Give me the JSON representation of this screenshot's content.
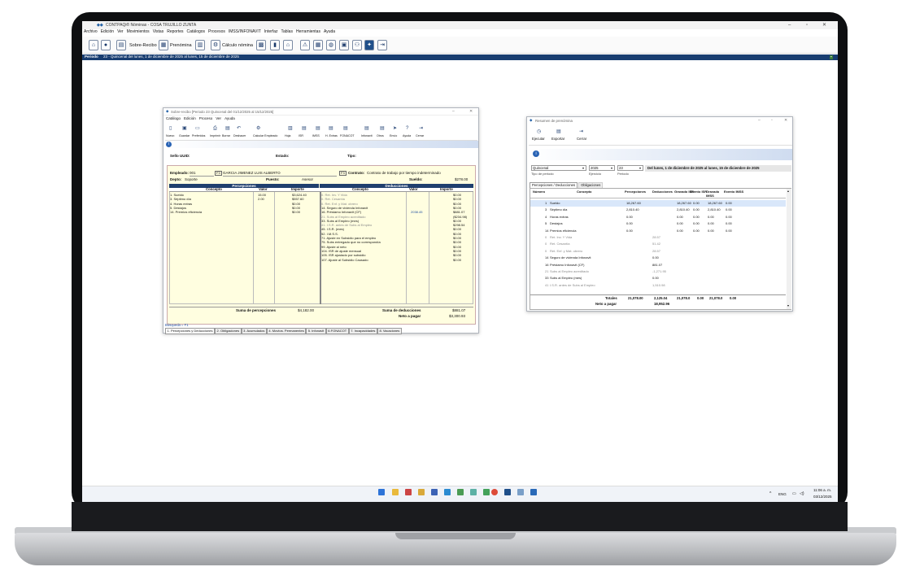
{
  "app": {
    "title": "CONTPAQi® Nóminas - COSA TRUJILLO ZUNTA",
    "menu": [
      "Archivo",
      "Edición",
      "Ver",
      "Movimientos",
      "Vistas",
      "Reportes",
      "Catálogos",
      "Procesos",
      "IMSS/INFONAVIT",
      "Interfaz",
      "Tablas",
      "Herramientas",
      "Ayuda"
    ],
    "toolbar": {
      "sobre_recibo": "Sobre-Recibo",
      "prenomina": "Prenómina",
      "calculo": "Cálculo nómina"
    },
    "period_label": "Periodo",
    "period_text": "23 - Quincenal del lunes, 1 de diciembre de 2025 al lunes, 15 de diciembre de 2025"
  },
  "sobre": {
    "title": "Sobre-recibo [Periodo 23 Quincenal del 01/12/2025 al 15/12/2025]",
    "menu": [
      "Catálogo",
      "Edición",
      "Proceso",
      "Ver",
      "Ayuda"
    ],
    "ribbon": [
      "Nuevo",
      "Guardar",
      "Preferidos",
      "Imprimir",
      "Borrar",
      "Deshacer",
      "Calcular Empleado",
      "Hoja",
      "ISR",
      "IMSS",
      "H. Extras",
      "FONACOT",
      "Infonavit",
      "Otros",
      "Envío",
      "Ayuda",
      "Cerrar"
    ],
    "sello_label": "Sello UUID:",
    "estado_label": "Estado:",
    "tipo_label": "Tipo:",
    "empleado_label": "Empleado:",
    "empleado_code": "001",
    "empleado_name": "GARCIA JIMENEZ LUIS ALBERTO",
    "contrato_label": "Contrato:",
    "contrato_value": "Contrato de trabajo por tiempo indeterminado",
    "depto_label": "Depto:",
    "depto_value": "Soporte",
    "puesto_label": "Puesto:",
    "puesto_value": "Asesor",
    "sueldo_label": "Sueldo:",
    "sueldo_value": "$278.00",
    "percepciones_header": "Percepciones",
    "deducciones_header": "Deducciones",
    "col_concepto": "Concepto",
    "col_valor": "Valor",
    "col_importe": "Importe",
    "percepciones": [
      {
        "c": "1. Sueldo",
        "v": "15.00",
        "i": "$3,624.40"
      },
      {
        "c": "3. Séptimo día",
        "v": "2.00",
        "i": "$557.60"
      },
      {
        "c": "4. Horas extras",
        "v": "",
        "i": "$0.00"
      },
      {
        "c": "5. Destajos",
        "v": "",
        "i": "$0.00"
      },
      {
        "c": "14. Premios eficiencia",
        "v": "",
        "i": "$0.00"
      }
    ],
    "deducciones": [
      {
        "c": "0. Ret. Inv. Y Vida",
        "v": "",
        "i": "$0.00",
        "g": true
      },
      {
        "c": "0. Ret. Cesantía",
        "v": "",
        "i": "$0.00",
        "g": true
      },
      {
        "c": "0. Ret. Enf. y Mat. obrero",
        "v": "",
        "i": "$0.00",
        "g": true
      },
      {
        "c": "14. Seguro de vivienda Infonavit",
        "v": "",
        "i": "$0.00",
        "g": false
      },
      {
        "c": "16. Préstamo Infonavit (CF)",
        "v": "2038.45",
        "i": "$881.07",
        "g": false
      },
      {
        "c": "21. Subs al Empleo acreditado",
        "v": "",
        "i": "($234.98)",
        "g": true
      },
      {
        "c": "33. Subs al Empleo (mes)",
        "v": "",
        "i": "$0.00",
        "g": false
      },
      {
        "c": "41. I.S.R. antes de Subs al Empleo",
        "v": "",
        "i": "$298.54",
        "g": true
      },
      {
        "c": "45. I.S.R. (mes)",
        "v": "",
        "i": "$0.00",
        "g": false
      },
      {
        "c": "52. I.M.S.S.",
        "v": "",
        "i": "$0.00",
        "g": false
      },
      {
        "c": "71. Ajuste en Subsidio para el empleo",
        "v": "",
        "i": "$0.00",
        "g": false
      },
      {
        "c": "75. Subs entregado que no correspondía",
        "v": "",
        "i": "$0.00",
        "g": false
      },
      {
        "c": "99. Ajuste al neto",
        "v": "",
        "i": "$0.00",
        "g": false
      },
      {
        "c": "104. ISR de ajuste mensual",
        "v": "",
        "i": "$0.00",
        "g": false
      },
      {
        "c": "105. ISR ajustado por subsidio",
        "v": "",
        "i": "$0.00",
        "g": false
      },
      {
        "c": "107. Ajuste al Subsidio Causado",
        "v": "",
        "i": "$0.00",
        "g": false
      }
    ],
    "suma_percepciones_label": "Suma de percepciones",
    "suma_percepciones": "$4,182.00",
    "suma_deducciones_label": "Suma de deducciones",
    "suma_deducciones": "$881.07",
    "neto_label": "Neto a pagar",
    "neto": "$3,300.93",
    "busqueda": "Búsqueda = F1",
    "tabs": [
      "1. Percepciones y Deducciones",
      "2. Obligaciones",
      "3. Acumulados",
      "4. Movtos. Permanentes",
      "5. Infonavit",
      "6.FONACOT",
      "7. Incapacidades",
      "8. Vacaciones"
    ]
  },
  "resumen": {
    "title": "Resumen de prenómina",
    "ribbon": [
      "Ejecutar",
      "Exportar",
      "Cerrar"
    ],
    "tipo_periodo": "Quincenal",
    "tipo_periodo_label": "Tipo de periodo",
    "ejercicio": "2025",
    "ejercicio_label": "Ejercicio",
    "periodo": "23",
    "periodo_label": "Periodo",
    "range": "Del lunes, 1 de diciembre de 2025 al lunes, 15 de diciembre de 2025",
    "tabs": [
      "Percepciones / Deducciones",
      "Obligaciones"
    ],
    "headers": [
      "Número",
      "Concepto",
      "Percepciones",
      "Deducciones",
      "Gravado ISR",
      "Exento ISR",
      "Gravado IMSS",
      "Exento IMSS"
    ],
    "rows": [
      {
        "n": "1",
        "c": "Sueldo",
        "p": "18,267.60",
        "d": "",
        "g1": "18,267.60",
        "e1": "0.00",
        "g2": "18,267.60",
        "e2": "0.00",
        "gr": false
      },
      {
        "n": "3",
        "c": "Séptimo día",
        "p": "2,810.40",
        "d": "",
        "g1": "2,810.40",
        "e1": "0.00",
        "g2": "2,810.40",
        "e2": "0.00",
        "gr": false
      },
      {
        "n": "4",
        "c": "Horas extras",
        "p": "0.00",
        "d": "",
        "g1": "0.00",
        "e1": "0.00",
        "g2": "0.00",
        "e2": "0.00",
        "gr": false
      },
      {
        "n": "5",
        "c": "Destajos",
        "p": "0.00",
        "d": "",
        "g1": "0.00",
        "e1": "0.00",
        "g2": "0.00",
        "e2": "0.00",
        "gr": false
      },
      {
        "n": "14",
        "c": "Premios eficiencia",
        "p": "0.00",
        "d": "",
        "g1": "0.00",
        "e1": "0.00",
        "g2": "0.00",
        "e2": "0.00",
        "gr": false
      },
      {
        "n": "0",
        "c": "Ret. Inv. Y Vida",
        "p": "",
        "d": "28.57",
        "g1": "",
        "e1": "",
        "g2": "",
        "e2": "",
        "gr": true
      },
      {
        "n": "0",
        "c": "Ret. Cesantía",
        "p": "",
        "d": "51.42",
        "g1": "",
        "e1": "",
        "g2": "",
        "e2": "",
        "gr": true
      },
      {
        "n": "0",
        "c": "Ret. Enf. y Mat. obrero",
        "p": "",
        "d": "28.57",
        "g1": "",
        "e1": "",
        "g2": "",
        "e2": "",
        "gr": true
      },
      {
        "n": "14",
        "c": "Seguro de vivienda Infonavit",
        "p": "",
        "d": "0.00",
        "g1": "",
        "e1": "",
        "g2": "",
        "e2": "",
        "gr": false
      },
      {
        "n": "16",
        "c": "Préstamo Infonavit (CF)",
        "p": "",
        "d": "881.07",
        "g1": "",
        "e1": "",
        "g2": "",
        "e2": "",
        "gr": false
      },
      {
        "n": "21",
        "c": "Subs al Empleo acreditado",
        "p": "",
        "d": "-1,271.95",
        "g1": "",
        "e1": "",
        "g2": "",
        "e2": "",
        "gr": true
      },
      {
        "n": "33",
        "c": "Subs al Empleo (mes)",
        "p": "",
        "d": "0.00",
        "g1": "",
        "e1": "",
        "g2": "",
        "e2": "",
        "gr": false
      },
      {
        "n": "41",
        "c": "I.S.R. antes de Subs al Empleo",
        "p": "",
        "d": "1,510.98",
        "g1": "",
        "e1": "",
        "g2": "",
        "e2": "",
        "gr": true
      }
    ],
    "totals_label": "Totales",
    "totals": [
      "21,078.00",
      "2,125.04",
      "21,078.0",
      "0.00",
      "21,078.0",
      "0.00"
    ],
    "neto_label": "Neto a pagar",
    "neto": "18,952.96"
  },
  "taskbar": {
    "lang": "ENG",
    "time": "11:06 a. m.",
    "date": "03/12/2025"
  }
}
